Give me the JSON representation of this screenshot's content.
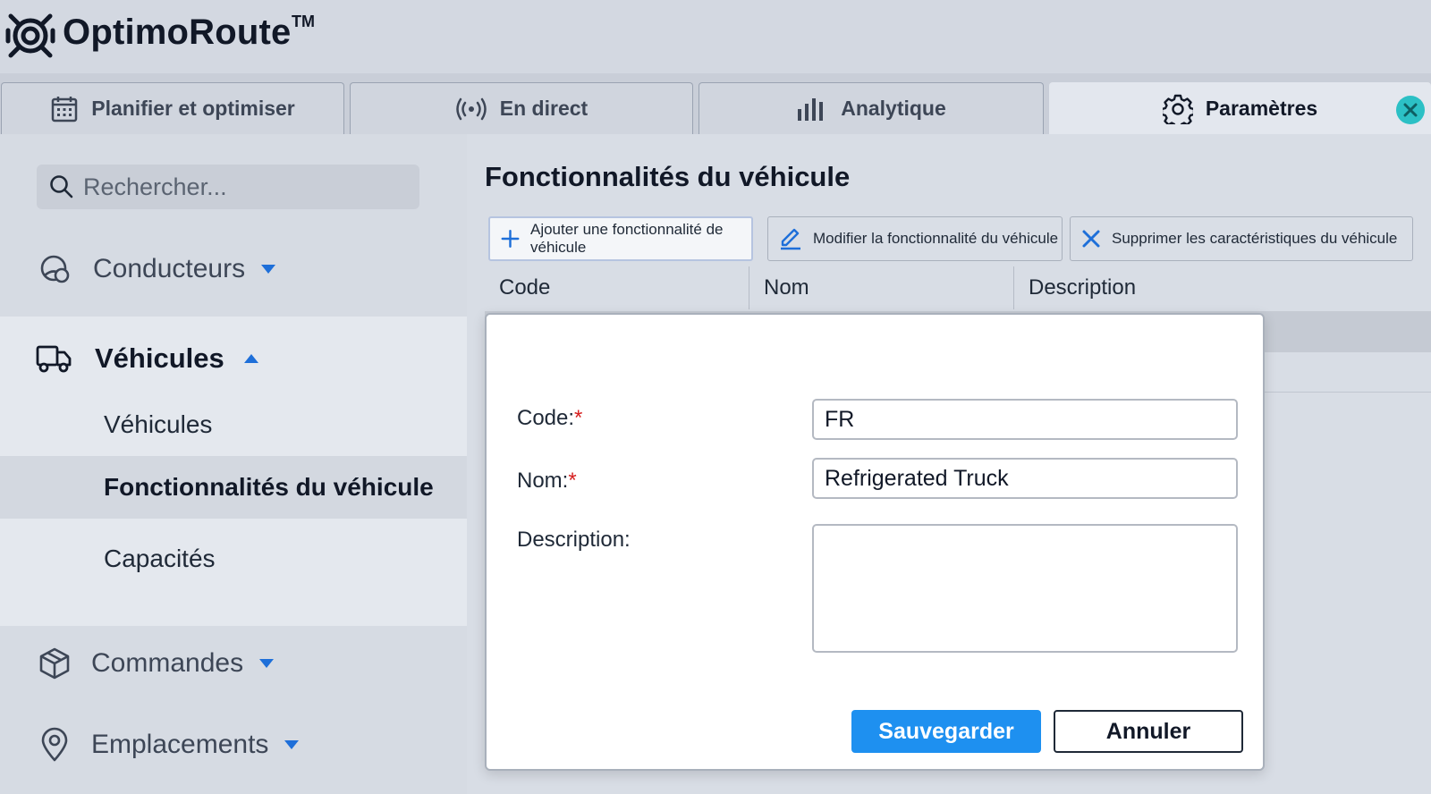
{
  "app": {
    "name": "OptimoRoute",
    "trademark": "TM"
  },
  "tabs": [
    {
      "label": "Planifier et optimiser",
      "icon": "calendar-icon"
    },
    {
      "label": "En direct",
      "icon": "live-broadcast-icon"
    },
    {
      "label": "Analytique",
      "icon": "bar-chart-icon"
    },
    {
      "label": "Paramètres",
      "icon": "gear-icon",
      "active": true
    }
  ],
  "sidebar": {
    "search_placeholder": "Rechercher...",
    "groups": {
      "drivers": "Conducteurs",
      "vehicles": "Véhicules",
      "orders": "Commandes",
      "locations": "Emplacements"
    },
    "vehicle_items": [
      {
        "label": "Véhicules"
      },
      {
        "label": "Fonctionnalités du véhicule",
        "selected": true
      },
      {
        "label": "Capacités"
      }
    ]
  },
  "main": {
    "title": "Fonctionnalités du véhicule",
    "toolbar": {
      "add": "Ajouter une fonctionnalité de véhicule",
      "edit": "Modifier la fonctionnalité du véhicule",
      "delete": "Supprimer les caractéristiques du véhicule"
    },
    "columns": [
      "Code",
      "Nom",
      "Description"
    ]
  },
  "modal": {
    "code_label": "Code:",
    "name_label": "Nom:",
    "description_label": "Description:",
    "required_mark": "*",
    "code_value": "FR",
    "name_value": "Refrigerated Truck",
    "description_value": "",
    "save": "Sauvegarder",
    "cancel": "Annuler"
  },
  "colors": {
    "accent": "#1e90f0",
    "close": "#2cc0c5",
    "required": "#d61f1f"
  }
}
